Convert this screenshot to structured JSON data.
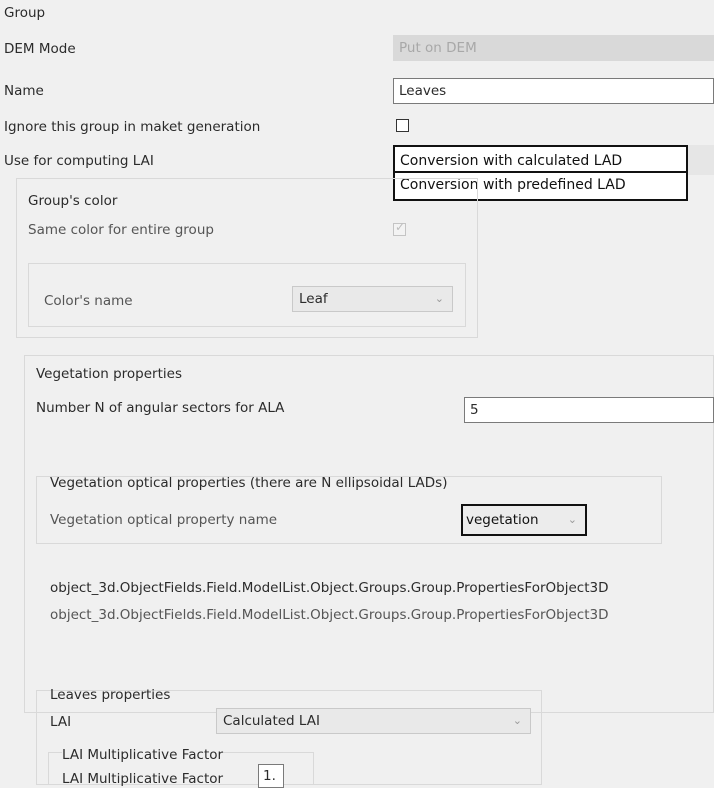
{
  "group_label": "Group",
  "dem_mode": {
    "label": "DEM Mode",
    "value": "Put on DEM"
  },
  "name": {
    "label": "Name",
    "value": "Leaves"
  },
  "ignore_group": {
    "label": "Ignore this group in maket generation",
    "checked": false
  },
  "lai_computing": {
    "label": "Use for computing LAI",
    "options": [
      "Conversion with calculated LAD",
      "Conversion with predefined LAD"
    ]
  },
  "group_color": {
    "title": "Group's color",
    "same_color": {
      "label": "Same color for entire group",
      "checked": true,
      "enabled": false
    },
    "color_name": {
      "label": "Color's name",
      "value": "Leaf"
    }
  },
  "vegetation": {
    "title": "Vegetation properties",
    "sectors": {
      "label": "Number N of angular sectors for ALA",
      "value": "5"
    },
    "optical": {
      "title": "Vegetation optical properties (there are N ellipsoidal LADs)",
      "property_label": "Vegetation optical property name",
      "property_value": "vegetation"
    },
    "paths": [
      "object_3d.ObjectFields.Field.ModelList.Object.Groups.Group.PropertiesForObject3D",
      "object_3d.ObjectFields.Field.ModelList.Object.Groups.Group.PropertiesForObject3D"
    ]
  },
  "leaves": {
    "title": "Leaves properties",
    "lai": {
      "label": "LAI",
      "value": "Calculated LAI"
    },
    "factor_box": {
      "title": "LAI Multiplicative Factor",
      "label": "LAI Multiplicative Factor",
      "value": "1."
    }
  }
}
